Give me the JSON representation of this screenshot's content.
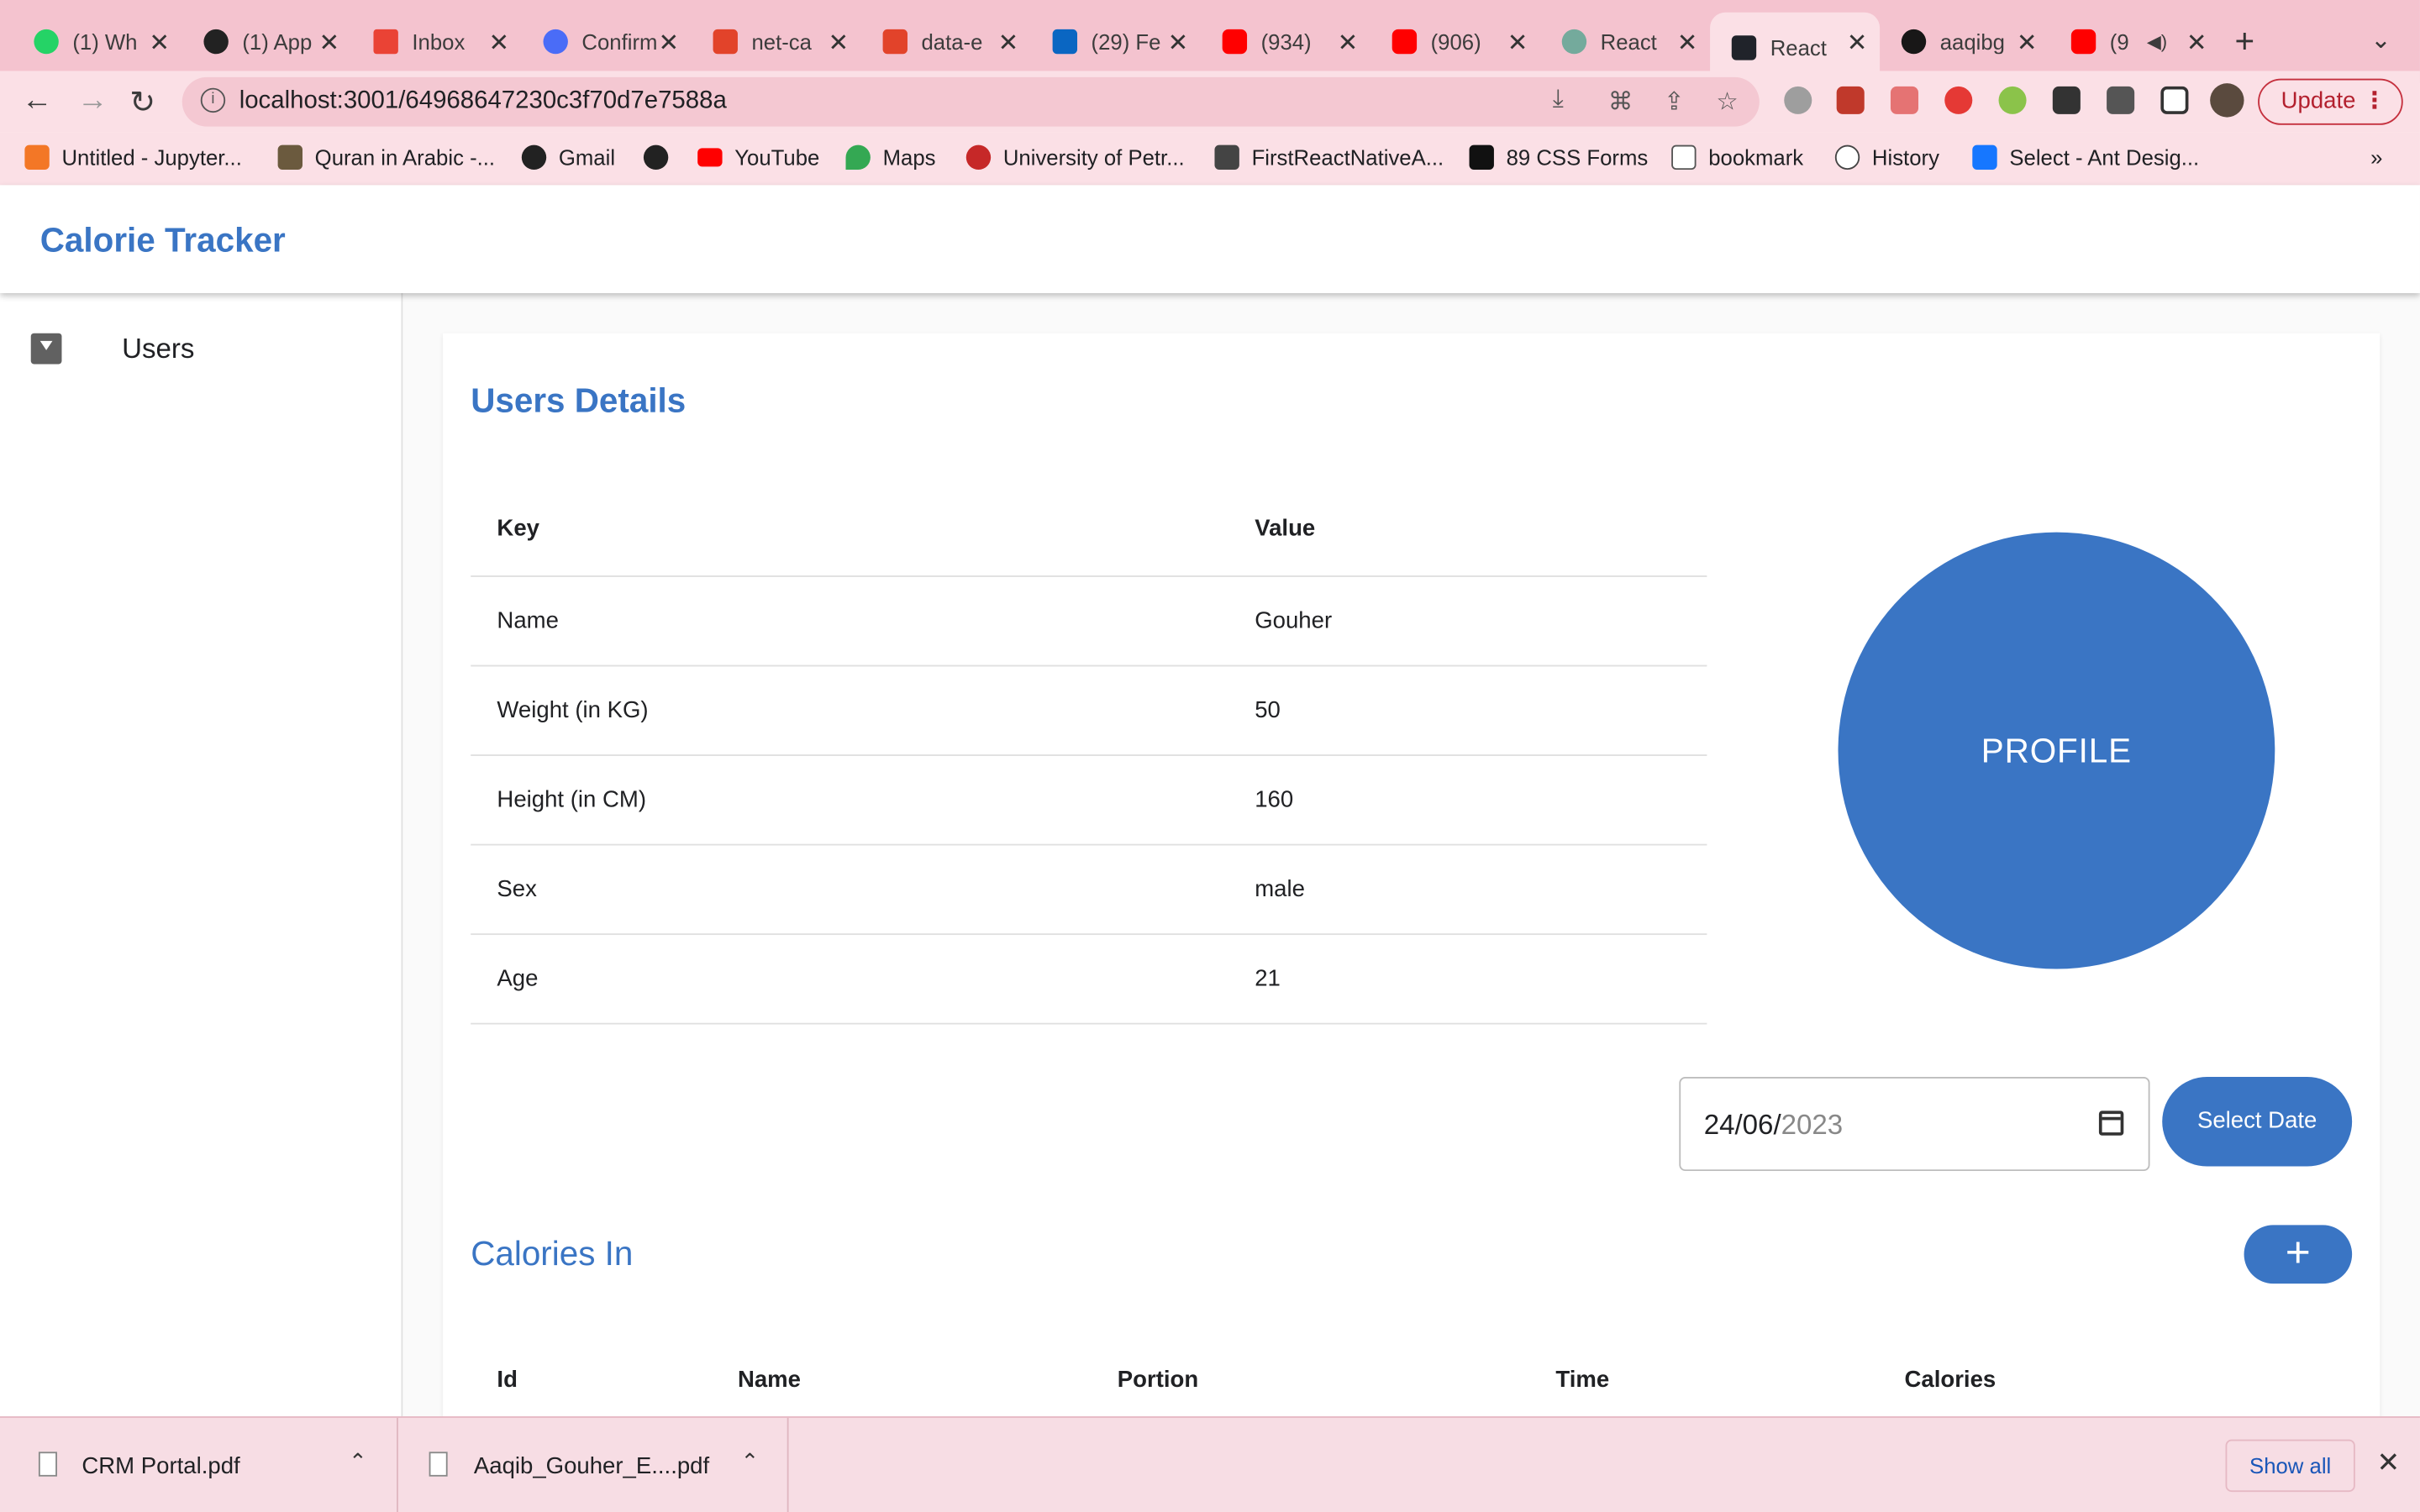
{
  "browser": {
    "tabs": [
      {
        "title": "(1) Wh",
        "color": "#25d366"
      },
      {
        "title": "(1) App",
        "color": "#222222"
      },
      {
        "title": "Inbox",
        "color": "#ea4335"
      },
      {
        "title": "Confirm",
        "color": "#4a6cf7"
      },
      {
        "title": "net-ca",
        "color": "#e2432a"
      },
      {
        "title": "data-e",
        "color": "#e2432a"
      },
      {
        "title": "(29) Fe",
        "color": "#0a66c2"
      },
      {
        "title": "(934)",
        "color": "#ff0000"
      },
      {
        "title": "(906)",
        "color": "#ff0000"
      },
      {
        "title": "React",
        "color": "#74aa9c"
      },
      {
        "title": "React",
        "color": "#20232a"
      },
      {
        "title": "aaqibg",
        "color": "#181717"
      },
      {
        "title": "(9",
        "color": "#ff0000"
      }
    ],
    "url": "localhost:3001/64968647230c3f70d7e7588a",
    "update_label": "Update",
    "bookmarks": [
      {
        "label": "Untitled - Jupyter...",
        "color": "#f37726"
      },
      {
        "label": "Quran in Arabic -...",
        "color": "#6b5a3e"
      },
      {
        "label": "Gmail",
        "color": "#222222"
      },
      {
        "label": "",
        "color": "#222222"
      },
      {
        "label": "YouTube",
        "color": "#ff0000"
      },
      {
        "label": "Maps",
        "color": "#34a853"
      },
      {
        "label": "University of Petr...",
        "color": "#c62828"
      },
      {
        "label": "FirstReactNativeA...",
        "color": "#444444"
      },
      {
        "label": "89 CSS Forms",
        "color": "#111111"
      },
      {
        "label": "bookmark",
        "color": "#666666"
      },
      {
        "label": "History",
        "color": "#444444"
      },
      {
        "label": "Select - Ant Desig...",
        "color": "#1677ff"
      }
    ],
    "bookmarks_more": "»"
  },
  "app": {
    "title": "Calorie Tracker",
    "sidebar": {
      "items": [
        {
          "label": "Users"
        }
      ]
    },
    "user_details": {
      "title": "Users Details",
      "columns": {
        "key": "Key",
        "value": "Value"
      },
      "rows": [
        {
          "key": "Name",
          "value": "Gouher"
        },
        {
          "key": "Weight (in KG)",
          "value": "50"
        },
        {
          "key": "Height (in CM)",
          "value": "160"
        },
        {
          "key": "Sex",
          "value": "male"
        },
        {
          "key": "Age",
          "value": "21"
        }
      ],
      "profile_label": "PROFILE"
    },
    "date_picker": {
      "day_month": "24/06/",
      "year": "2023",
      "button_label": "Select Date"
    },
    "calories_in": {
      "title": "Calories In",
      "add_label": "+",
      "columns": [
        "Id",
        "Name",
        "Portion",
        "Time",
        "Calories"
      ]
    },
    "accent_color": "#3a75c4"
  },
  "downloads": {
    "items": [
      {
        "name": "CRM Portal.pdf"
      },
      {
        "name": "Aaqib_Gouher_E....pdf"
      }
    ],
    "show_all": "Show all"
  }
}
